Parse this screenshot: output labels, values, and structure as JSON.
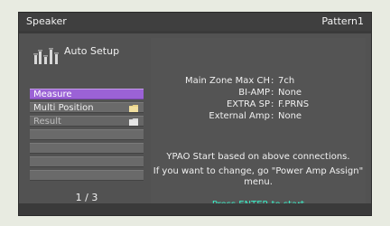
{
  "header": {
    "title": "Speaker",
    "pattern": "Pattern1"
  },
  "sidebar": {
    "title": "Auto Setup",
    "icon": "speaker-level-icon",
    "items": [
      {
        "label": "Measure",
        "state": "active"
      },
      {
        "label": "Multi Position",
        "state": "normal",
        "icon": "folder-icon"
      },
      {
        "label": "Result",
        "state": "disabled",
        "icon": "folder-icon"
      },
      {
        "label": "",
        "state": "empty"
      },
      {
        "label": "",
        "state": "empty"
      },
      {
        "label": "",
        "state": "empty"
      },
      {
        "label": "",
        "state": "empty"
      }
    ],
    "page_indicator": "1 / 3"
  },
  "panel": {
    "connections": [
      {
        "key": "Main Zone Max CH",
        "value": "7ch"
      },
      {
        "key": "BI-AMP",
        "value": "None"
      },
      {
        "key": "EXTRA SP",
        "value": "F.PRNS"
      },
      {
        "key": "External Amp",
        "value": "None"
      }
    ],
    "message_1": "YPAO Start based on above connections.",
    "message_2": "If you want to change, go \"Power Amp Assign\" menu.",
    "call_to_action": "Press ENTER to start",
    "colors": {
      "selection": "#9b62d6",
      "cta": "#3af0c8",
      "panel_bg": "#545454"
    }
  }
}
